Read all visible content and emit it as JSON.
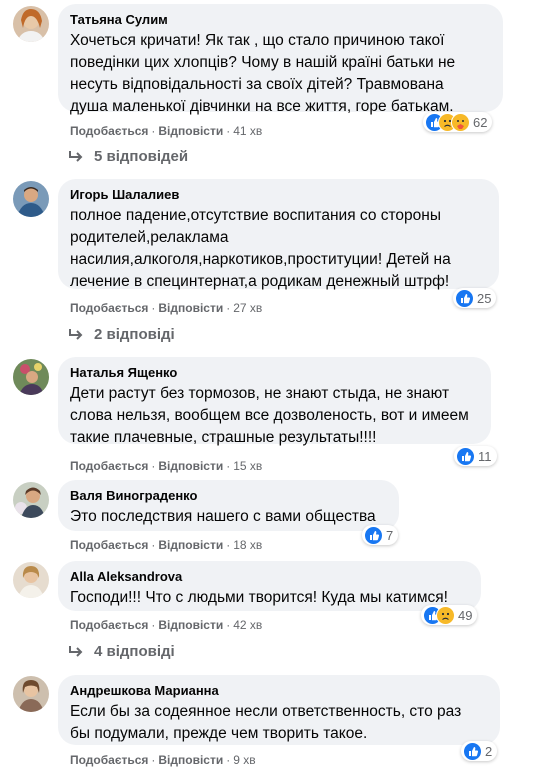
{
  "comments": [
    {
      "author": "Татьяна Сулим",
      "text": "Хочеться кричати! Як так , що стало причиною такої\nповедінки цих хлопців? Чому в нашій країні батьки не\nнесуть відповідальності за своїх дітей? Травмована\nдуша маленької дівчинки на все життя, горе батькам.",
      "like_label": "Подобається",
      "reply_label": "Відповісти",
      "time": "41 хв",
      "reaction_icons": [
        "like-icon",
        "sad-icon",
        "care-icon"
      ],
      "reaction_count": "62",
      "replies_label": "5 відповідей"
    },
    {
      "author": "Игорь Шалалиев",
      "text": "полное падение,отсутствие воспитания со стороны\nродителей,релаклама\nнасилия,алкоголя,наркотиков,проституции! Детей на\nлечение в специнтернат,а родикам денежный штрф!",
      "like_label": "Подобається",
      "reply_label": "Відповісти",
      "time": "27 хв",
      "reaction_icons": [
        "like-icon"
      ],
      "reaction_count": "25",
      "replies_label": "2 відповіді"
    },
    {
      "author": "Наталья Ященко",
      "text": "Дети растут без тормозов, не знают стыда, не знают\nслова нельзя, вообщем все дозволеность, вот и имеем\nтакие плачевные, страшные результаты!!!!",
      "like_label": "Подобається",
      "reply_label": "Відповісти",
      "time": "15 хв",
      "reaction_icons": [
        "like-icon"
      ],
      "reaction_count": "11"
    },
    {
      "author": "Валя Винограденко",
      "text": "Это последствия нашего с вами общества",
      "like_label": "Подобається",
      "reply_label": "Відповісти",
      "time": "18 хв",
      "reaction_icons": [
        "like-icon"
      ],
      "reaction_count": "7"
    },
    {
      "author": "Alla Aleksandrova",
      "text": "Господи!!! Что с людьми творится! Куда мы катимся!",
      "like_label": "Подобається",
      "reply_label": "Відповісти",
      "time": "42 хв",
      "reaction_icons": [
        "like-icon",
        "sad-icon"
      ],
      "reaction_count": "49",
      "replies_label": "4 відповіді"
    },
    {
      "author": "Андрешкова Марианна",
      "text": "Если бы за содеянное несли ответственность, сто раз\nбы подумали, прежде чем творить такое.",
      "like_label": "Подобається",
      "reply_label": "Відповісти",
      "time": "9 хв",
      "reaction_icons": [
        "like-icon"
      ],
      "reaction_count": "2"
    }
  ],
  "separator": "·",
  "colors": {
    "bubble": "#f0f2f5",
    "meta_text": "#65676b",
    "like_blue": "#1877f2",
    "reaction_yellow": "#f7b928"
  }
}
